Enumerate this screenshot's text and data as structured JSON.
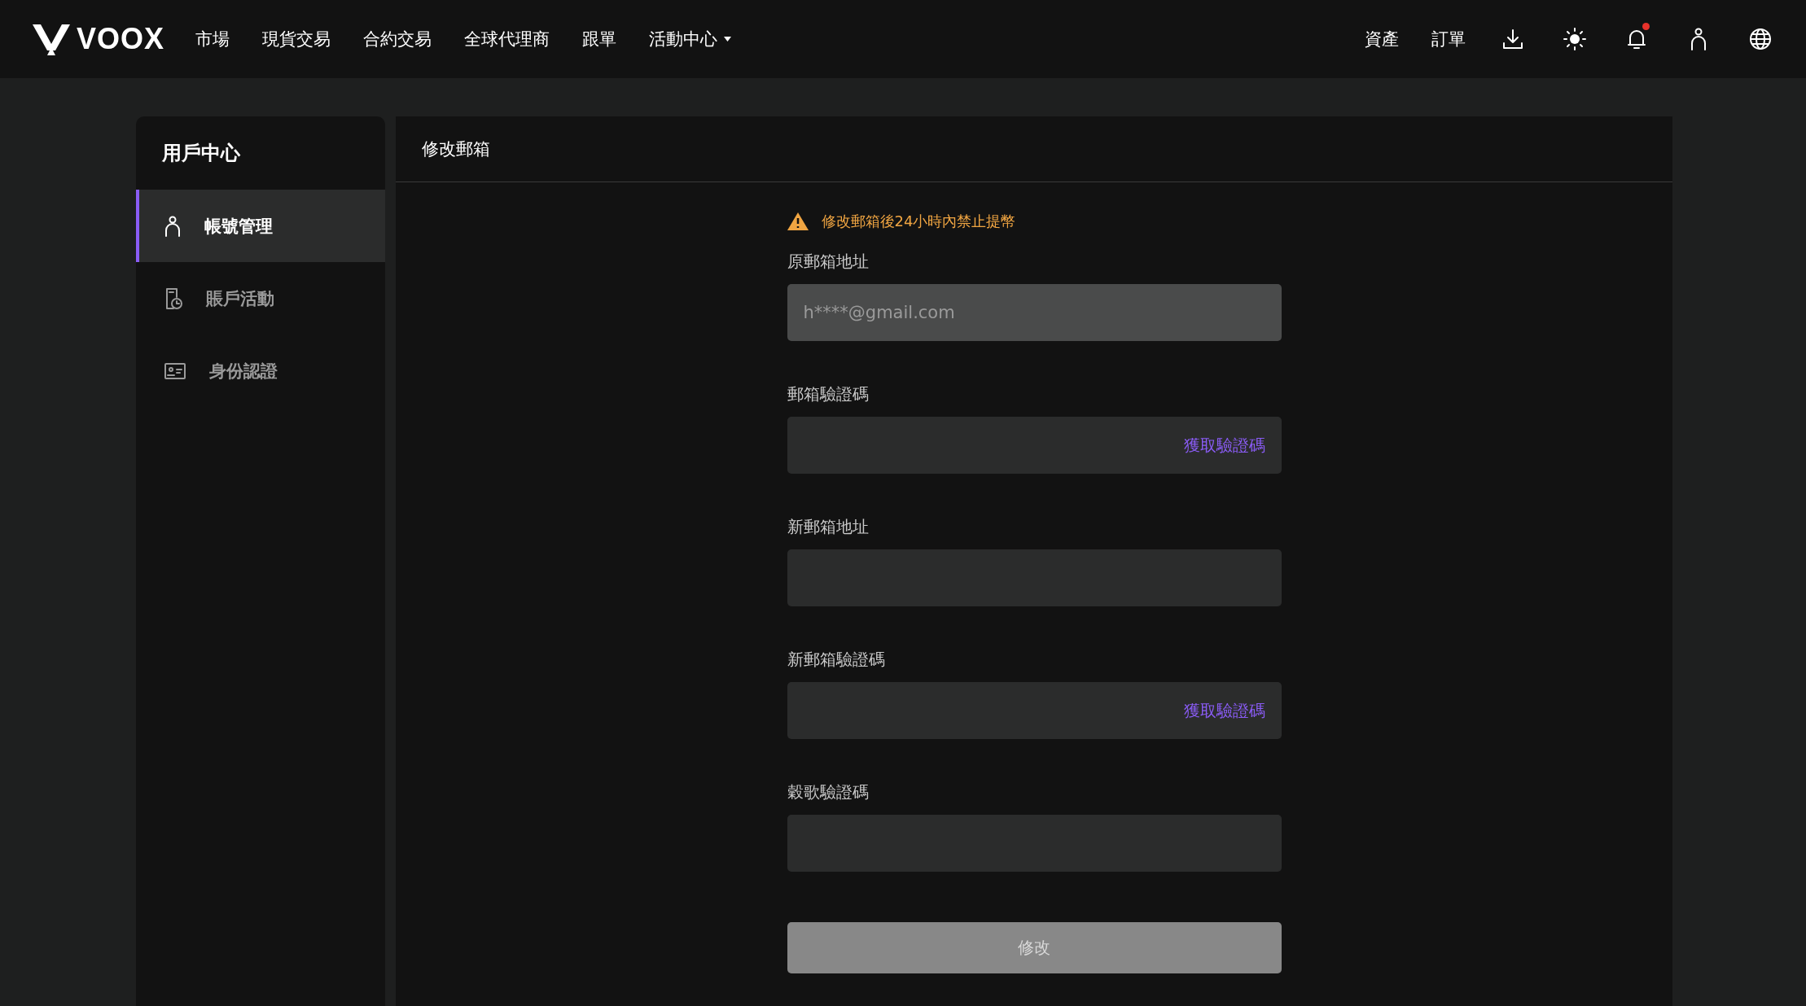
{
  "header": {
    "logo": "VOOX",
    "nav": [
      {
        "label": "市場",
        "dropdown": false
      },
      {
        "label": "現貨交易",
        "dropdown": false
      },
      {
        "label": "合約交易",
        "dropdown": false
      },
      {
        "label": "全球代理商",
        "dropdown": false
      },
      {
        "label": "跟單",
        "dropdown": false
      },
      {
        "label": "活動中心",
        "dropdown": true
      }
    ],
    "links": [
      "資產",
      "訂單"
    ],
    "notification_unread": true
  },
  "sidebar": {
    "title": "用戶中心",
    "items": [
      {
        "label": "帳號管理",
        "kind": "account",
        "selected": true
      },
      {
        "label": "賬戶活動",
        "kind": "activity",
        "selected": false
      },
      {
        "label": "身份認證",
        "kind": "identity",
        "selected": false
      }
    ]
  },
  "main": {
    "title": "修改郵箱",
    "warning": "修改郵箱後24小時內禁止提幣",
    "fields": [
      {
        "label": "原郵箱地址",
        "kind": "readonly",
        "value": "h****@gmail.com"
      },
      {
        "label": "郵箱驗證碼",
        "kind": "code",
        "action": "獲取驗證碼"
      },
      {
        "label": "新郵箱地址",
        "kind": "text"
      },
      {
        "label": "新郵箱驗證碼",
        "kind": "code",
        "action": "獲取驗證碼"
      },
      {
        "label": "穀歌驗證碼",
        "kind": "text"
      }
    ],
    "submit": {
      "label": "修改",
      "disabled": true
    }
  }
}
